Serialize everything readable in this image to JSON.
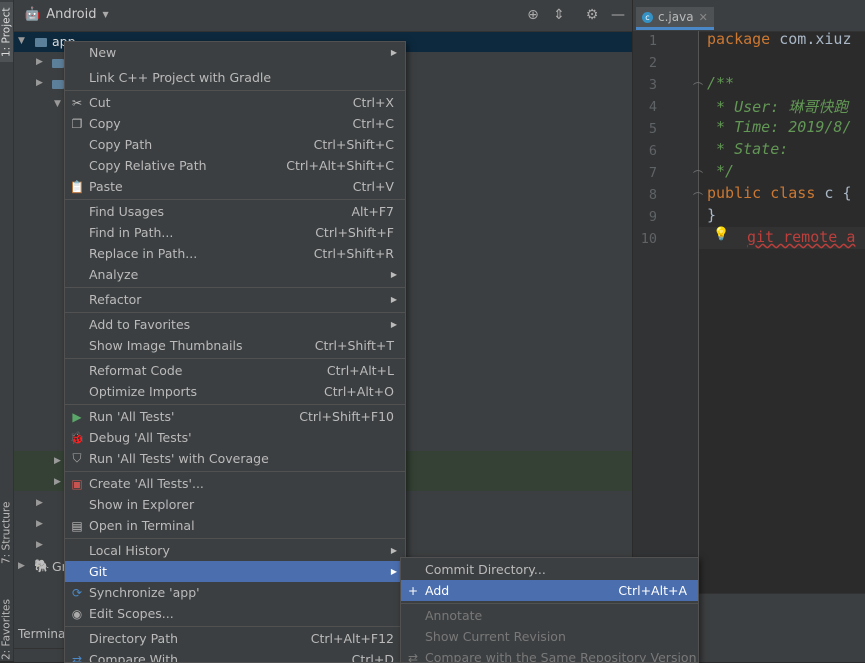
{
  "sidebar": {
    "project_tab": "1: Project",
    "structure_tab": "7: Structure",
    "favorites_tab": "2: Favorites"
  },
  "project": {
    "view_mode": "Android",
    "root_item": "app",
    "partial_item": "Gr",
    "terminal_label": "Terminal"
  },
  "editor": {
    "tab_label": "c.java",
    "line_numbers": [
      "1",
      "2",
      "3",
      "4",
      "5",
      "6",
      "7",
      "8",
      "9",
      "10"
    ],
    "lines": {
      "l1_kw": "package",
      "l1_rest": " com.xiuz",
      "l3": "/**",
      "l4": " * User: 琳哥快跑",
      "l5": " * Time: 2019/8/",
      "l6": " * State:",
      "l7": " */",
      "l8_kw": "public class",
      "l8_rest": " c {",
      "l9": "}",
      "l10": "git remote a"
    }
  },
  "context_menu": {
    "items": [
      {
        "label": "New",
        "shortcut": "",
        "submenu": true,
        "icon": ""
      },
      {
        "label": "Link C++ Project with Gradle",
        "shortcut": "",
        "submenu": false,
        "icon": ""
      },
      {
        "label": "Cut",
        "shortcut": "Ctrl+X",
        "submenu": false,
        "icon": "✂"
      },
      {
        "label": "Copy",
        "shortcut": "Ctrl+C",
        "submenu": false,
        "icon": "❐"
      },
      {
        "label": "Copy Path",
        "shortcut": "Ctrl+Shift+C",
        "submenu": false,
        "icon": ""
      },
      {
        "label": "Copy Relative Path",
        "shortcut": "Ctrl+Alt+Shift+C",
        "submenu": false,
        "icon": ""
      },
      {
        "label": "Paste",
        "shortcut": "Ctrl+V",
        "submenu": false,
        "icon": "📋"
      },
      {
        "label": "Find Usages",
        "shortcut": "Alt+F7",
        "submenu": false,
        "icon": ""
      },
      {
        "label": "Find in Path...",
        "shortcut": "Ctrl+Shift+F",
        "submenu": false,
        "icon": ""
      },
      {
        "label": "Replace in Path...",
        "shortcut": "Ctrl+Shift+R",
        "submenu": false,
        "icon": ""
      },
      {
        "label": "Analyze",
        "shortcut": "",
        "submenu": true,
        "icon": ""
      },
      {
        "label": "Refactor",
        "shortcut": "",
        "submenu": true,
        "icon": ""
      },
      {
        "label": "Add to Favorites",
        "shortcut": "",
        "submenu": true,
        "icon": ""
      },
      {
        "label": "Show Image Thumbnails",
        "shortcut": "Ctrl+Shift+T",
        "submenu": false,
        "icon": ""
      },
      {
        "label": "Reformat Code",
        "shortcut": "Ctrl+Alt+L",
        "submenu": false,
        "icon": ""
      },
      {
        "label": "Optimize Imports",
        "shortcut": "Ctrl+Alt+O",
        "submenu": false,
        "icon": ""
      },
      {
        "label": "Run 'All Tests'",
        "shortcut": "Ctrl+Shift+F10",
        "submenu": false,
        "icon": "▶"
      },
      {
        "label": "Debug 'All Tests'",
        "shortcut": "",
        "submenu": false,
        "icon": "🐞"
      },
      {
        "label": "Run 'All Tests' with Coverage",
        "shortcut": "",
        "submenu": false,
        "icon": "⛉"
      },
      {
        "label": "Create 'All Tests'...",
        "shortcut": "",
        "submenu": false,
        "icon": "▣"
      },
      {
        "label": "Show in Explorer",
        "shortcut": "",
        "submenu": false,
        "icon": ""
      },
      {
        "label": "Open in Terminal",
        "shortcut": "",
        "submenu": false,
        "icon": "▤"
      },
      {
        "label": "Local History",
        "shortcut": "",
        "submenu": true,
        "icon": ""
      },
      {
        "label": "Git",
        "shortcut": "",
        "submenu": true,
        "icon": ""
      },
      {
        "label": "Synchronize 'app'",
        "shortcut": "",
        "submenu": false,
        "icon": "⟳"
      },
      {
        "label": "Edit Scopes...",
        "shortcut": "",
        "submenu": false,
        "icon": "◉"
      },
      {
        "label": "Directory Path",
        "shortcut": "Ctrl+Alt+F12",
        "submenu": false,
        "icon": ""
      },
      {
        "label": "Compare With...",
        "shortcut": "Ctrl+D",
        "submenu": false,
        "icon": "⇄"
      }
    ]
  },
  "git_submenu": {
    "items": [
      {
        "label": "Commit Directory...",
        "shortcut": ""
      },
      {
        "label": "Add",
        "shortcut": "Ctrl+Alt+A",
        "icon": "+"
      },
      {
        "label": "Annotate",
        "shortcut": ""
      },
      {
        "label": "Show Current Revision",
        "shortcut": ""
      },
      {
        "label": "Compare with the Same Repository Version",
        "shortcut": "",
        "icon": "⇄"
      }
    ]
  },
  "colors": {
    "menu_highlight": "#4b6eaf",
    "menu_bg": "#3c3f41",
    "editor_bg": "#2b2b2b",
    "keyword": "#cc7832",
    "comment": "#629755",
    "error": "#bc3f3c"
  }
}
